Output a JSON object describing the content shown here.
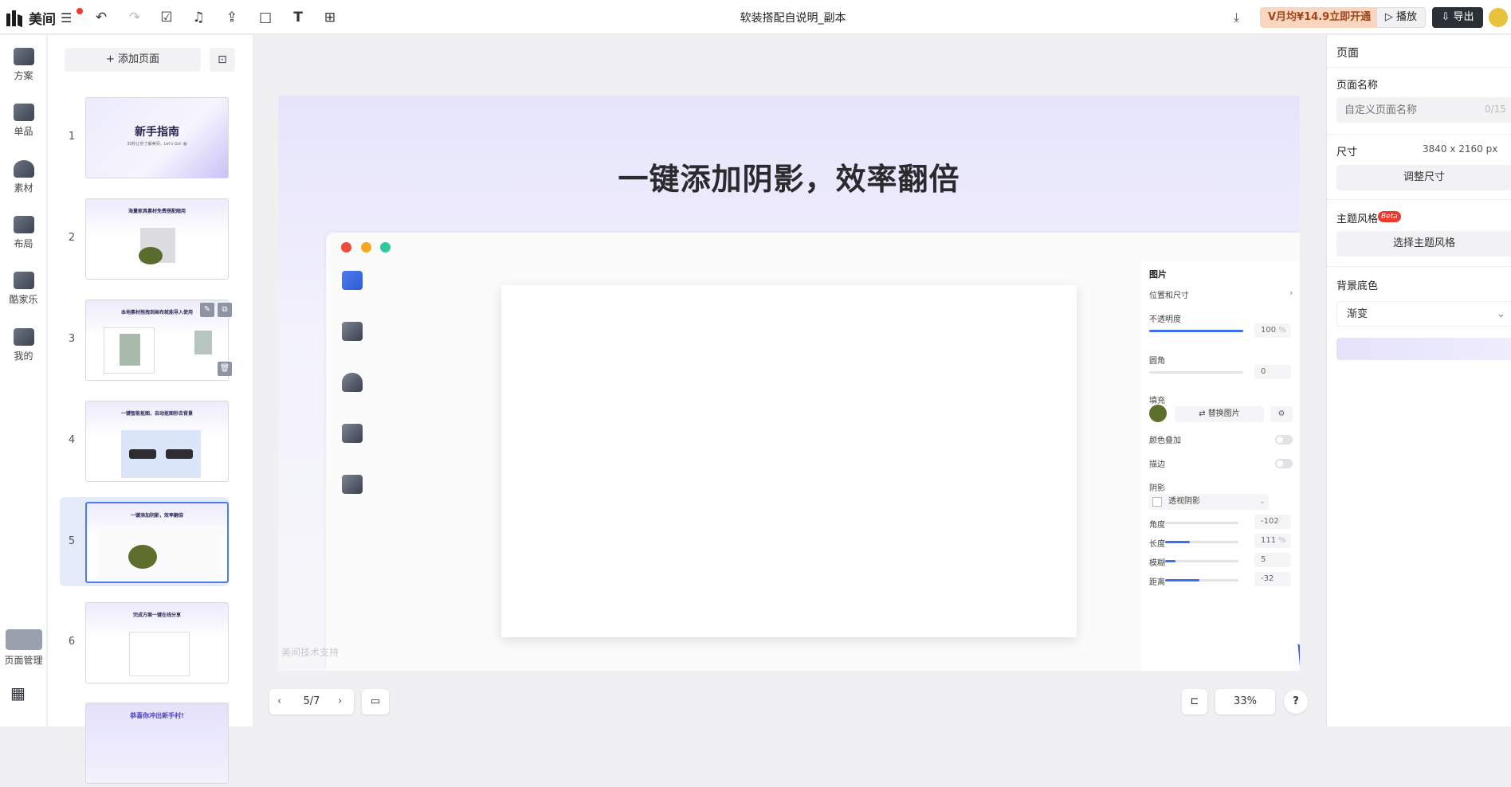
{
  "app": {
    "name": "美间",
    "menu_icon": "menu-icon"
  },
  "toolbar": {
    "doc_title": "软装搭配自说明_副本",
    "vip_label": "V月均¥14.9立即开通",
    "play_label": "▷ 播放",
    "export_label": "⇩ 导出"
  },
  "leftnav": {
    "items": [
      {
        "label": "方案"
      },
      {
        "label": "单品"
      },
      {
        "label": "素材"
      },
      {
        "label": "布局"
      },
      {
        "label": "酷家乐"
      },
      {
        "label": "我的"
      }
    ],
    "page_manage": "页面管理"
  },
  "pages": {
    "add_label": "+ 添加页面",
    "thumbs": [
      {
        "num": "1",
        "title": "新手指南",
        "subtitle": "30秒让你了解美间，Let's Go! 😀"
      },
      {
        "num": "2",
        "title": "海量家具素材免费搭配随用"
      },
      {
        "num": "3",
        "title": "本地素材拖拽到画布就能导入使用"
      },
      {
        "num": "4",
        "title": "一键智能抠图，自动抠图秒去背景"
      },
      {
        "num": "5",
        "title": "一键添加阴影，效率翻倍"
      },
      {
        "num": "6",
        "title": "完成方案一键在线分享"
      },
      {
        "num": "",
        "title": "恭喜你冲出新手村!"
      }
    ]
  },
  "slide": {
    "title": "一键添加阴影，效率翻倍",
    "watermark": "美间技术支持",
    "props": {
      "header": "图片",
      "pos_size": "位置和尺寸",
      "opacity_label": "不透明度",
      "opacity_value": "100",
      "opacity_unit": "%",
      "opacity_fraction": 1.0,
      "radius_label": "圆角",
      "radius_value": "0",
      "fill_label": "填充",
      "replace_label": "⇄ 替换图片",
      "color_overlay": "颜色叠加",
      "stroke": "描边",
      "shadow": "阴影",
      "shadow_type": "透视阴影",
      "angle_label": "角度",
      "angle_value": "-102",
      "length_label": "长度",
      "length_value": "111",
      "length_unit": "%",
      "blur_label": "模糊",
      "blur_value": "5",
      "distance_label": "距离",
      "distance_value": "-32"
    }
  },
  "bottom": {
    "page_indicator": "5/7",
    "zoom": "33%",
    "help": "?"
  },
  "rightpanel": {
    "title": "页面",
    "page_name_label": "页面名称",
    "page_name_placeholder": "自定义页面名称",
    "page_name_count": "0/15",
    "size_label": "尺寸",
    "size_value": "3840 x 2160 px",
    "resize_label": "调整尺寸",
    "theme_label": "主题风格",
    "beta": "Beta",
    "theme_button": "选择主题风格",
    "bg_label": "背景底色",
    "bg_value": "渐变"
  },
  "colors": {
    "accent": "#4d7cf0",
    "vip_bg": "#f8d6bf",
    "export_bg": "#2b2f36"
  }
}
